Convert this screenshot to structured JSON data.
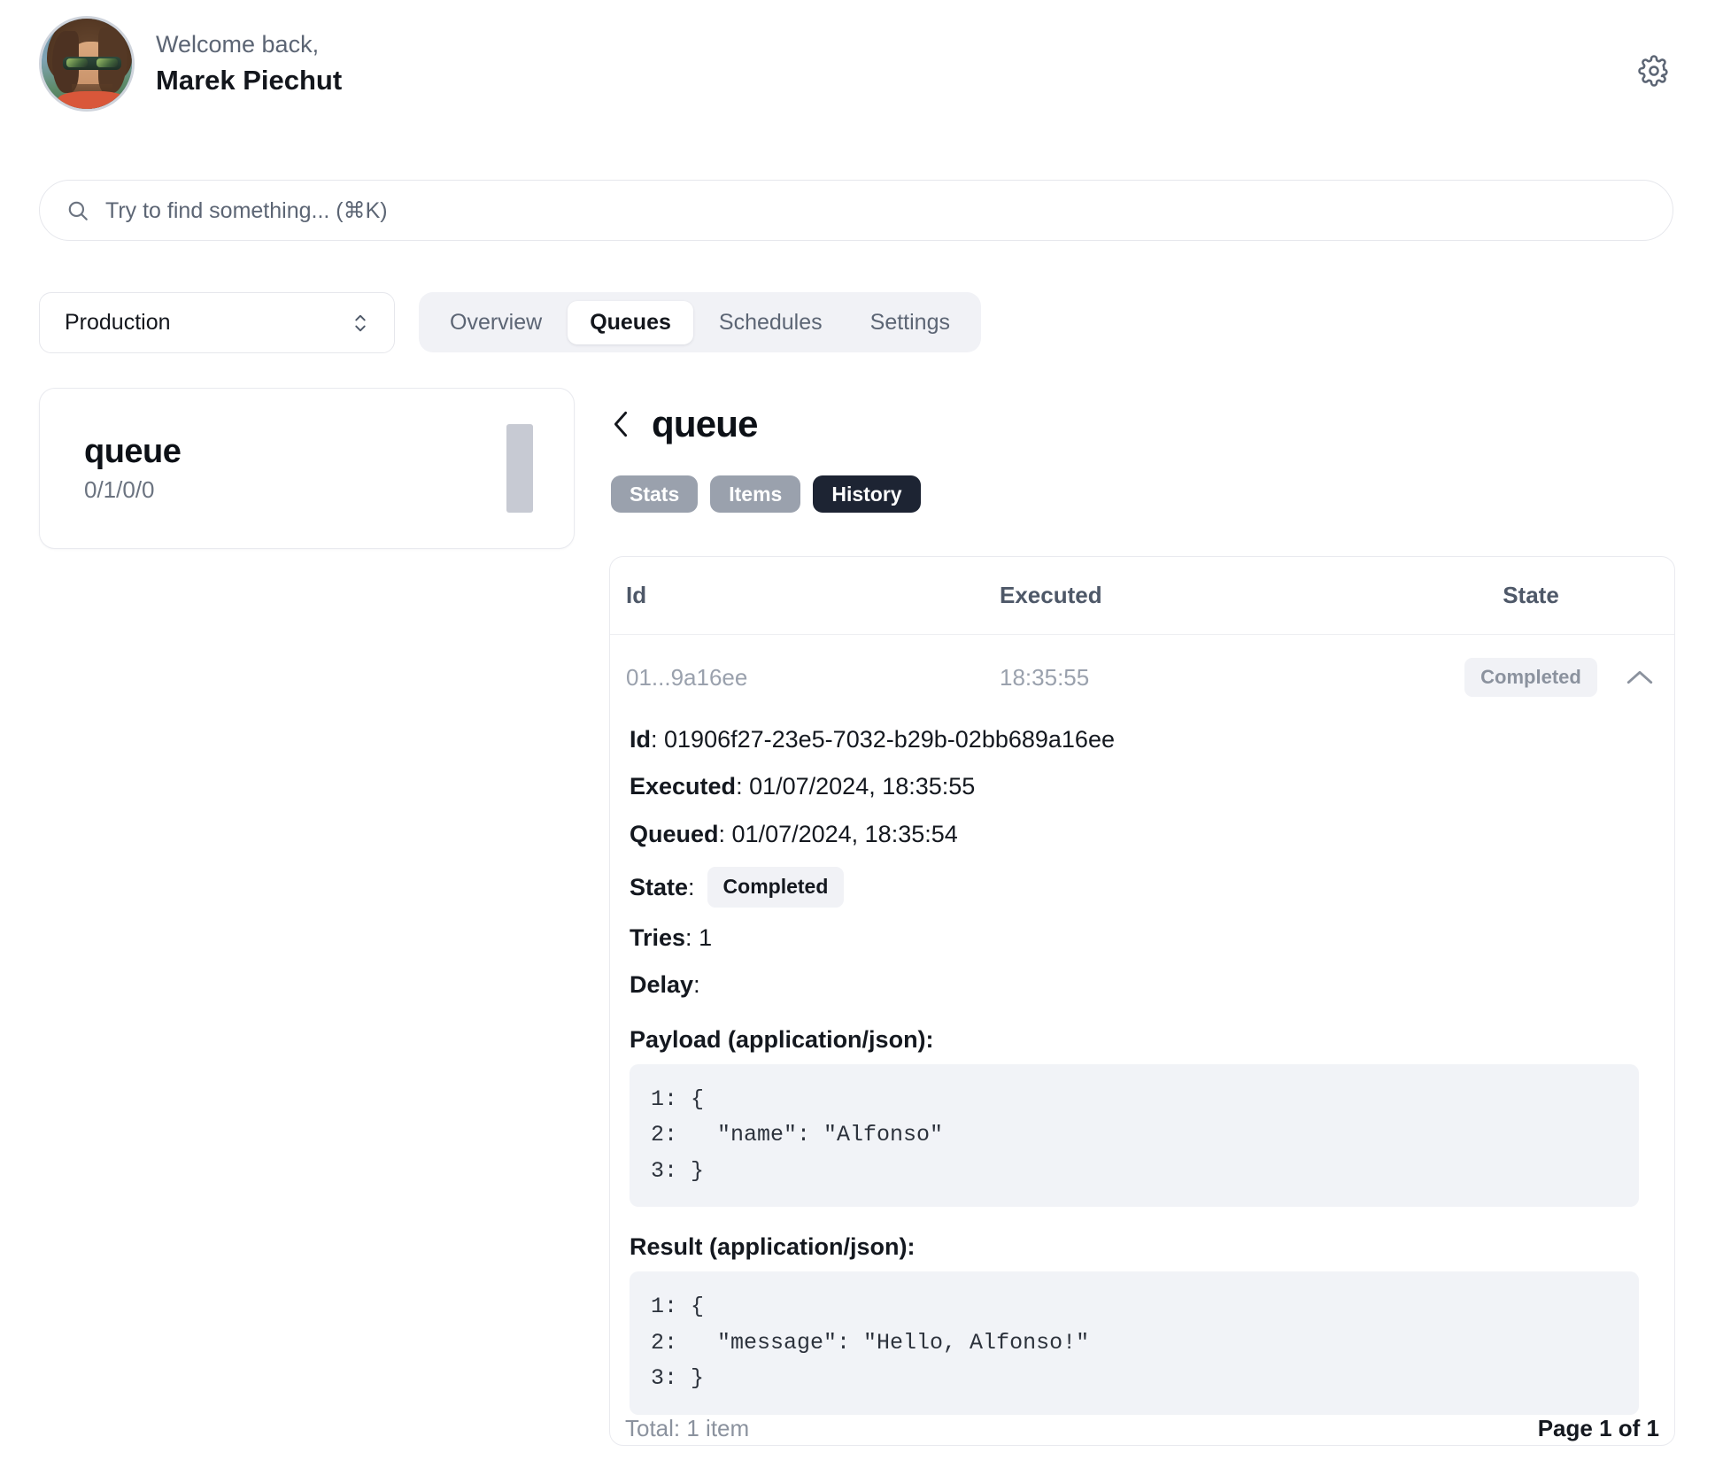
{
  "header": {
    "welcome_prefix": "Welcome back,",
    "user_name": "Marek Piechut",
    "avatar_name": "user-avatar",
    "settings_icon": "gear-icon"
  },
  "search": {
    "placeholder": "Try to find something... (⌘K)",
    "value": "",
    "icon": "search-icon"
  },
  "environment": {
    "selected": "Production",
    "options": [
      "Production"
    ],
    "icon": "chevron-up-down-icon"
  },
  "nav_tabs": [
    {
      "label": "Overview",
      "active": false
    },
    {
      "label": "Queues",
      "active": true
    },
    {
      "label": "Schedules",
      "active": false
    },
    {
      "label": "Settings",
      "active": false
    }
  ],
  "queue_list": [
    {
      "name": "queue",
      "counts": "0/1/0/0"
    }
  ],
  "detail": {
    "back_icon": "chevron-left-icon",
    "title": "queue",
    "pills": [
      {
        "label": "Stats",
        "active": false
      },
      {
        "label": "Items",
        "active": false
      },
      {
        "label": "History",
        "active": true
      }
    ]
  },
  "history_table": {
    "columns": [
      "Id",
      "Executed",
      "State"
    ],
    "rows": [
      {
        "id_short": "01...9a16ee",
        "executed_time": "18:35:55",
        "state": "Completed",
        "toggle_icon": "chevron-up-icon",
        "expanded": true,
        "fields": {
          "id_label": "Id",
          "id_value": "01906f27-23e5-7032-b29b-02bb689a16ee",
          "executed_label": "Executed",
          "executed_value": "01/07/2024, 18:35:55",
          "queued_label": "Queued",
          "queued_value": "01/07/2024, 18:35:54",
          "state_label": "State",
          "state_value": "Completed",
          "tries_label": "Tries",
          "tries_value": "1",
          "delay_label": "Delay",
          "delay_value": ""
        },
        "payload": {
          "label": "Payload (application/json):",
          "lines": [
            "1: {",
            "2:   \"name\": \"Alfonso\"",
            "3: }"
          ]
        },
        "result": {
          "label": "Result (application/json):",
          "lines": [
            "1: {",
            "2:   \"message\": \"Hello, Alfonso!\"",
            "3: }"
          ]
        }
      }
    ],
    "footer": {
      "total": "Total: 1 item",
      "page": "Page 1 of 1"
    }
  },
  "colors": {
    "accent_dark": "#1d2433",
    "pill_inactive": "#9aa1ad",
    "muted_text": "#8b929e",
    "border": "#e9eaef",
    "code_bg": "#f1f3f7",
    "tab_track": "#f1f2f6",
    "queue_bar": "#c7cad3"
  }
}
